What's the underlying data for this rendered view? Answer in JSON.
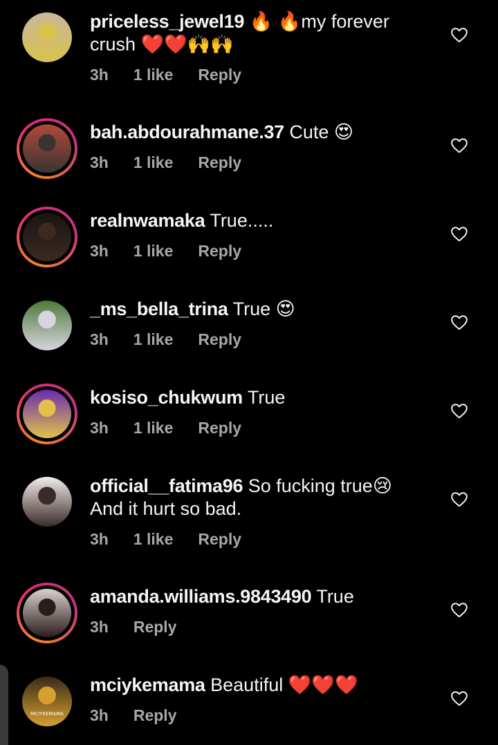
{
  "comments": [
    {
      "username": "priceless_jewel19",
      "text_line1": "🔥 🔥my forever",
      "text_line2": "crush ❤️❤️🙌🙌",
      "time": "3h",
      "likes": "1 like",
      "reply": "Reply",
      "avatar_ring": false,
      "avatar_colors": [
        "#c9b79c",
        "#d8c24a"
      ]
    },
    {
      "username": "bah.abdourahmane.37",
      "text_line1": "Cute 😍",
      "time": "3h",
      "likes": "1 like",
      "reply": "Reply",
      "avatar_ring": true,
      "avatar_colors": [
        "#b04a3a",
        "#3a3430"
      ]
    },
    {
      "username": "realnwamaka",
      "text_line1": "True.....",
      "time": "3h",
      "likes": "1 like",
      "reply": "Reply",
      "avatar_ring": true,
      "avatar_colors": [
        "#1a1412",
        "#3b2a22"
      ]
    },
    {
      "username": "_ms_bella_trina",
      "text_line1": "True 😍",
      "time": "3h",
      "likes": "1 like",
      "reply": "Reply",
      "avatar_ring": false,
      "avatar_colors": [
        "#4d7a3a",
        "#d9d4e0"
      ]
    },
    {
      "username": "kosiso_chukwum",
      "text_line1": "True",
      "time": "3h",
      "likes": "1 like",
      "reply": "Reply",
      "avatar_ring": true,
      "avatar_colors": [
        "#6a2bb0",
        "#e0c24a"
      ]
    },
    {
      "username": "official__fatima96",
      "text_line1": "So fucking true😢",
      "text_line2": "And it hurt so bad.",
      "time": "3h",
      "likes": "1 like",
      "reply": "Reply",
      "avatar_ring": false,
      "avatar_colors": [
        "#f2ecec",
        "#3a2a28"
      ]
    },
    {
      "username": "amanda.williams.9843490",
      "text_line1": "True",
      "time": "3h",
      "likes": "",
      "reply": "Reply",
      "avatar_ring": true,
      "avatar_colors": [
        "#d9d0cc",
        "#2a1c1a"
      ]
    },
    {
      "username": "mciykemama",
      "text_line1": "Beautiful ❤️❤️❤️",
      "time": "3h",
      "likes": "",
      "reply": "Reply",
      "avatar_ring": false,
      "avatar_colors": [
        "#3a2a1a",
        "#d6a030"
      ],
      "avatar_text": "MCIYKEMAMA"
    }
  ],
  "icons": {
    "like": "heart-outline-icon"
  },
  "colors": {
    "background": "#000000",
    "text": "#f5f5f5",
    "meta": "#a8a8a8"
  }
}
